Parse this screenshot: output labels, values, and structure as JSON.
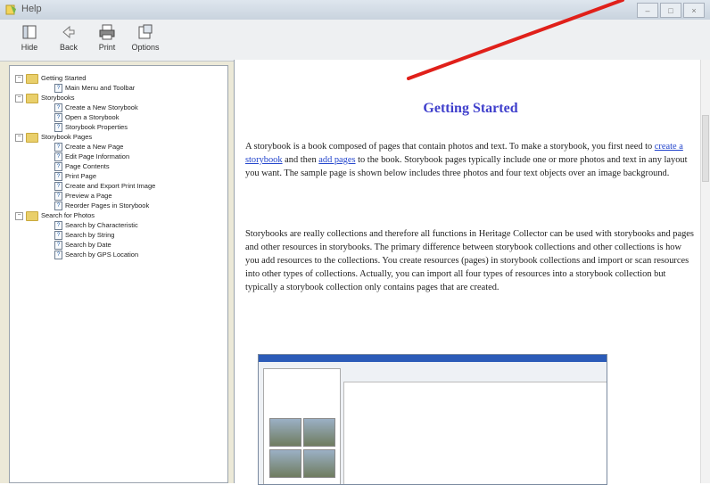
{
  "window": {
    "title": "Help"
  },
  "toolbar": {
    "hide_label": "Hide",
    "back_label": "Back",
    "print_label": "Print",
    "options_label": "Options"
  },
  "tree": {
    "groups": [
      {
        "label": "Getting Started",
        "children": [
          "Main Menu and Toolbar"
        ]
      },
      {
        "label": "Storybooks",
        "children": [
          "Create a New Storybook",
          "Open a Storybook",
          "Storybook Properties"
        ]
      },
      {
        "label": "Storybook Pages",
        "children": [
          "Create a New Page",
          "Edit Page Information",
          "Page Contents",
          "Print Page",
          "Create and Export Print Image",
          "Preview a Page",
          "Reorder Pages in Storybook"
        ]
      },
      {
        "label": "Search for Photos",
        "children": [
          "Search by Characteristic",
          "Search by String",
          "Search by Date",
          "Search by GPS Location"
        ]
      }
    ]
  },
  "content": {
    "heading": "Getting Started",
    "p1_a": "A storybook is a book composed of pages that contain photos and text. To make a storybook, you first need to ",
    "p1_link1": "create a storybook",
    "p1_b": " and then ",
    "p1_link2": "add pages",
    "p1_c": " to the book. Storybook pages typically include one or more photos and text in any layout you want. The sample page is shown below includes three photos and four text objects over an image background.",
    "p2": "Storybooks are really collections and therefore all functions in Heritage Collector can be used with storybooks and pages and other resources in storybooks. The primary difference between storybook collections and other collections is how you add resources to the collections. You create resources (pages) in storybook collections and import or scan resources into other types of collections. Actually, you can import all four types of resources into a storybook collection but typically a storybook collection only contains pages that are created."
  },
  "colors": {
    "heading": "#3f3fcc",
    "link": "#2244cc",
    "annotation": "#e0201a"
  }
}
